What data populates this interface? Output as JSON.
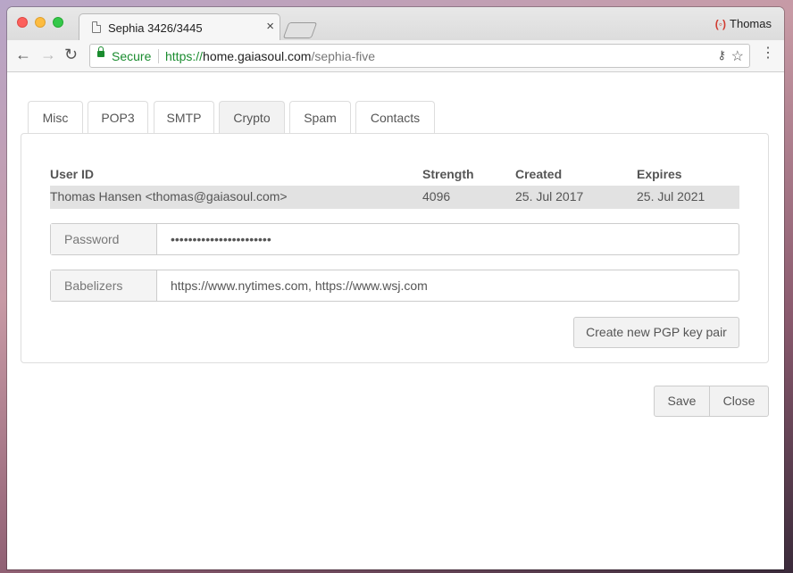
{
  "browser": {
    "tab_title": "Sephia 3426/3445",
    "tab_close": "×",
    "profile_icon": "(◦)",
    "profile_name": "Thomas",
    "nav": {
      "back": "←",
      "forward": "→",
      "reload": "↻"
    },
    "security_label": "Secure",
    "url": {
      "scheme": "https://",
      "host": "home.gaiasoul.com",
      "path": "/sephia-five"
    },
    "icons": {
      "key": "⚷",
      "star": "☆",
      "menu": "⋮"
    },
    "accent_color": "#1a8c2f"
  },
  "tabs": [
    {
      "label": "Misc"
    },
    {
      "label": "POP3"
    },
    {
      "label": "SMTP"
    },
    {
      "label": "Crypto",
      "active": true
    },
    {
      "label": "Spam"
    },
    {
      "label": "Contacts"
    }
  ],
  "keys_table": {
    "headers": {
      "user_id": "User ID",
      "strength": "Strength",
      "created": "Created",
      "expires": "Expires"
    },
    "rows": [
      {
        "user_id": "Thomas Hansen <thomas@gaiasoul.com>",
        "strength": "4096",
        "created": "25. Jul 2017",
        "expires": "25. Jul 2021"
      }
    ]
  },
  "password": {
    "label": "Password",
    "value": "•••••••••••••••••••••••"
  },
  "babelizers": {
    "label": "Babelizers",
    "value": "https://www.nytimes.com, https://www.wsj.com"
  },
  "create_key_button": "Create new PGP key pair",
  "footer": {
    "save": "Save",
    "close": "Close"
  }
}
